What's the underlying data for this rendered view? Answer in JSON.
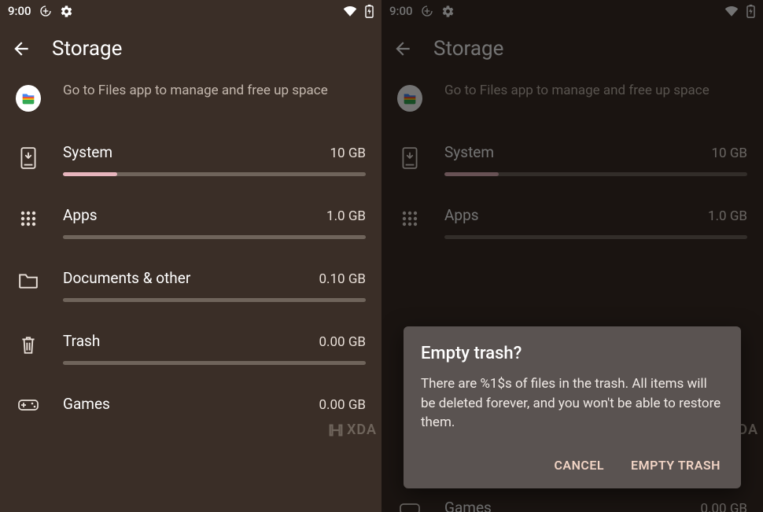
{
  "statusbar": {
    "time": "9:00"
  },
  "appbar": {
    "title": "Storage"
  },
  "files_tip": {
    "desc": "Go to Files app to manage and free up space"
  },
  "categories": [
    {
      "id": "system",
      "name": "System",
      "size": "10 GB",
      "fill_percent": 18
    },
    {
      "id": "apps",
      "name": "Apps",
      "size": "1.0 GB",
      "fill_percent": 0
    },
    {
      "id": "documents",
      "name": "Documents & other",
      "size": "0.10 GB",
      "fill_percent": 0
    },
    {
      "id": "trash",
      "name": "Trash",
      "size": "0.00 GB",
      "fill_percent": 0
    },
    {
      "id": "games",
      "name": "Games",
      "size": "0.00 GB",
      "fill_percent": 0
    }
  ],
  "dialog": {
    "title": "Empty trash?",
    "body": "There are %1$s of files in the trash. All items will be deleted forever, and you won't be able to restore them.",
    "cancel": "CANCEL",
    "confirm": "EMPTY TRASH"
  },
  "watermark": "XDA"
}
